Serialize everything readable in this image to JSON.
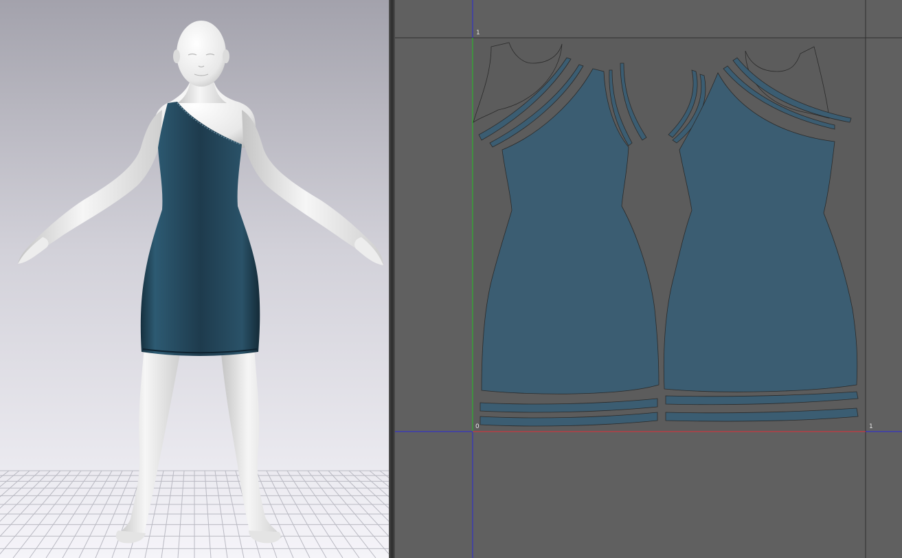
{
  "viewport_3d": {
    "avatar": "female-avatar",
    "garment": "one-shoulder-dress",
    "garment_color": "#1f3a4d",
    "avatar_color": "#efefef",
    "background_top": "#a3a2ac",
    "background_bottom": "#f4f3f8",
    "floor_grid": true
  },
  "uv_editor": {
    "background_color": "#606060",
    "tile_color": "#5b5b5b",
    "pattern_fill": "#3b5d72",
    "u_axis_color": "#e0303a",
    "v_axis_color": "#22c322",
    "guide_color": "#2828d8",
    "labels": {
      "origin": "0",
      "u_one": "1",
      "v_one": "1"
    }
  }
}
